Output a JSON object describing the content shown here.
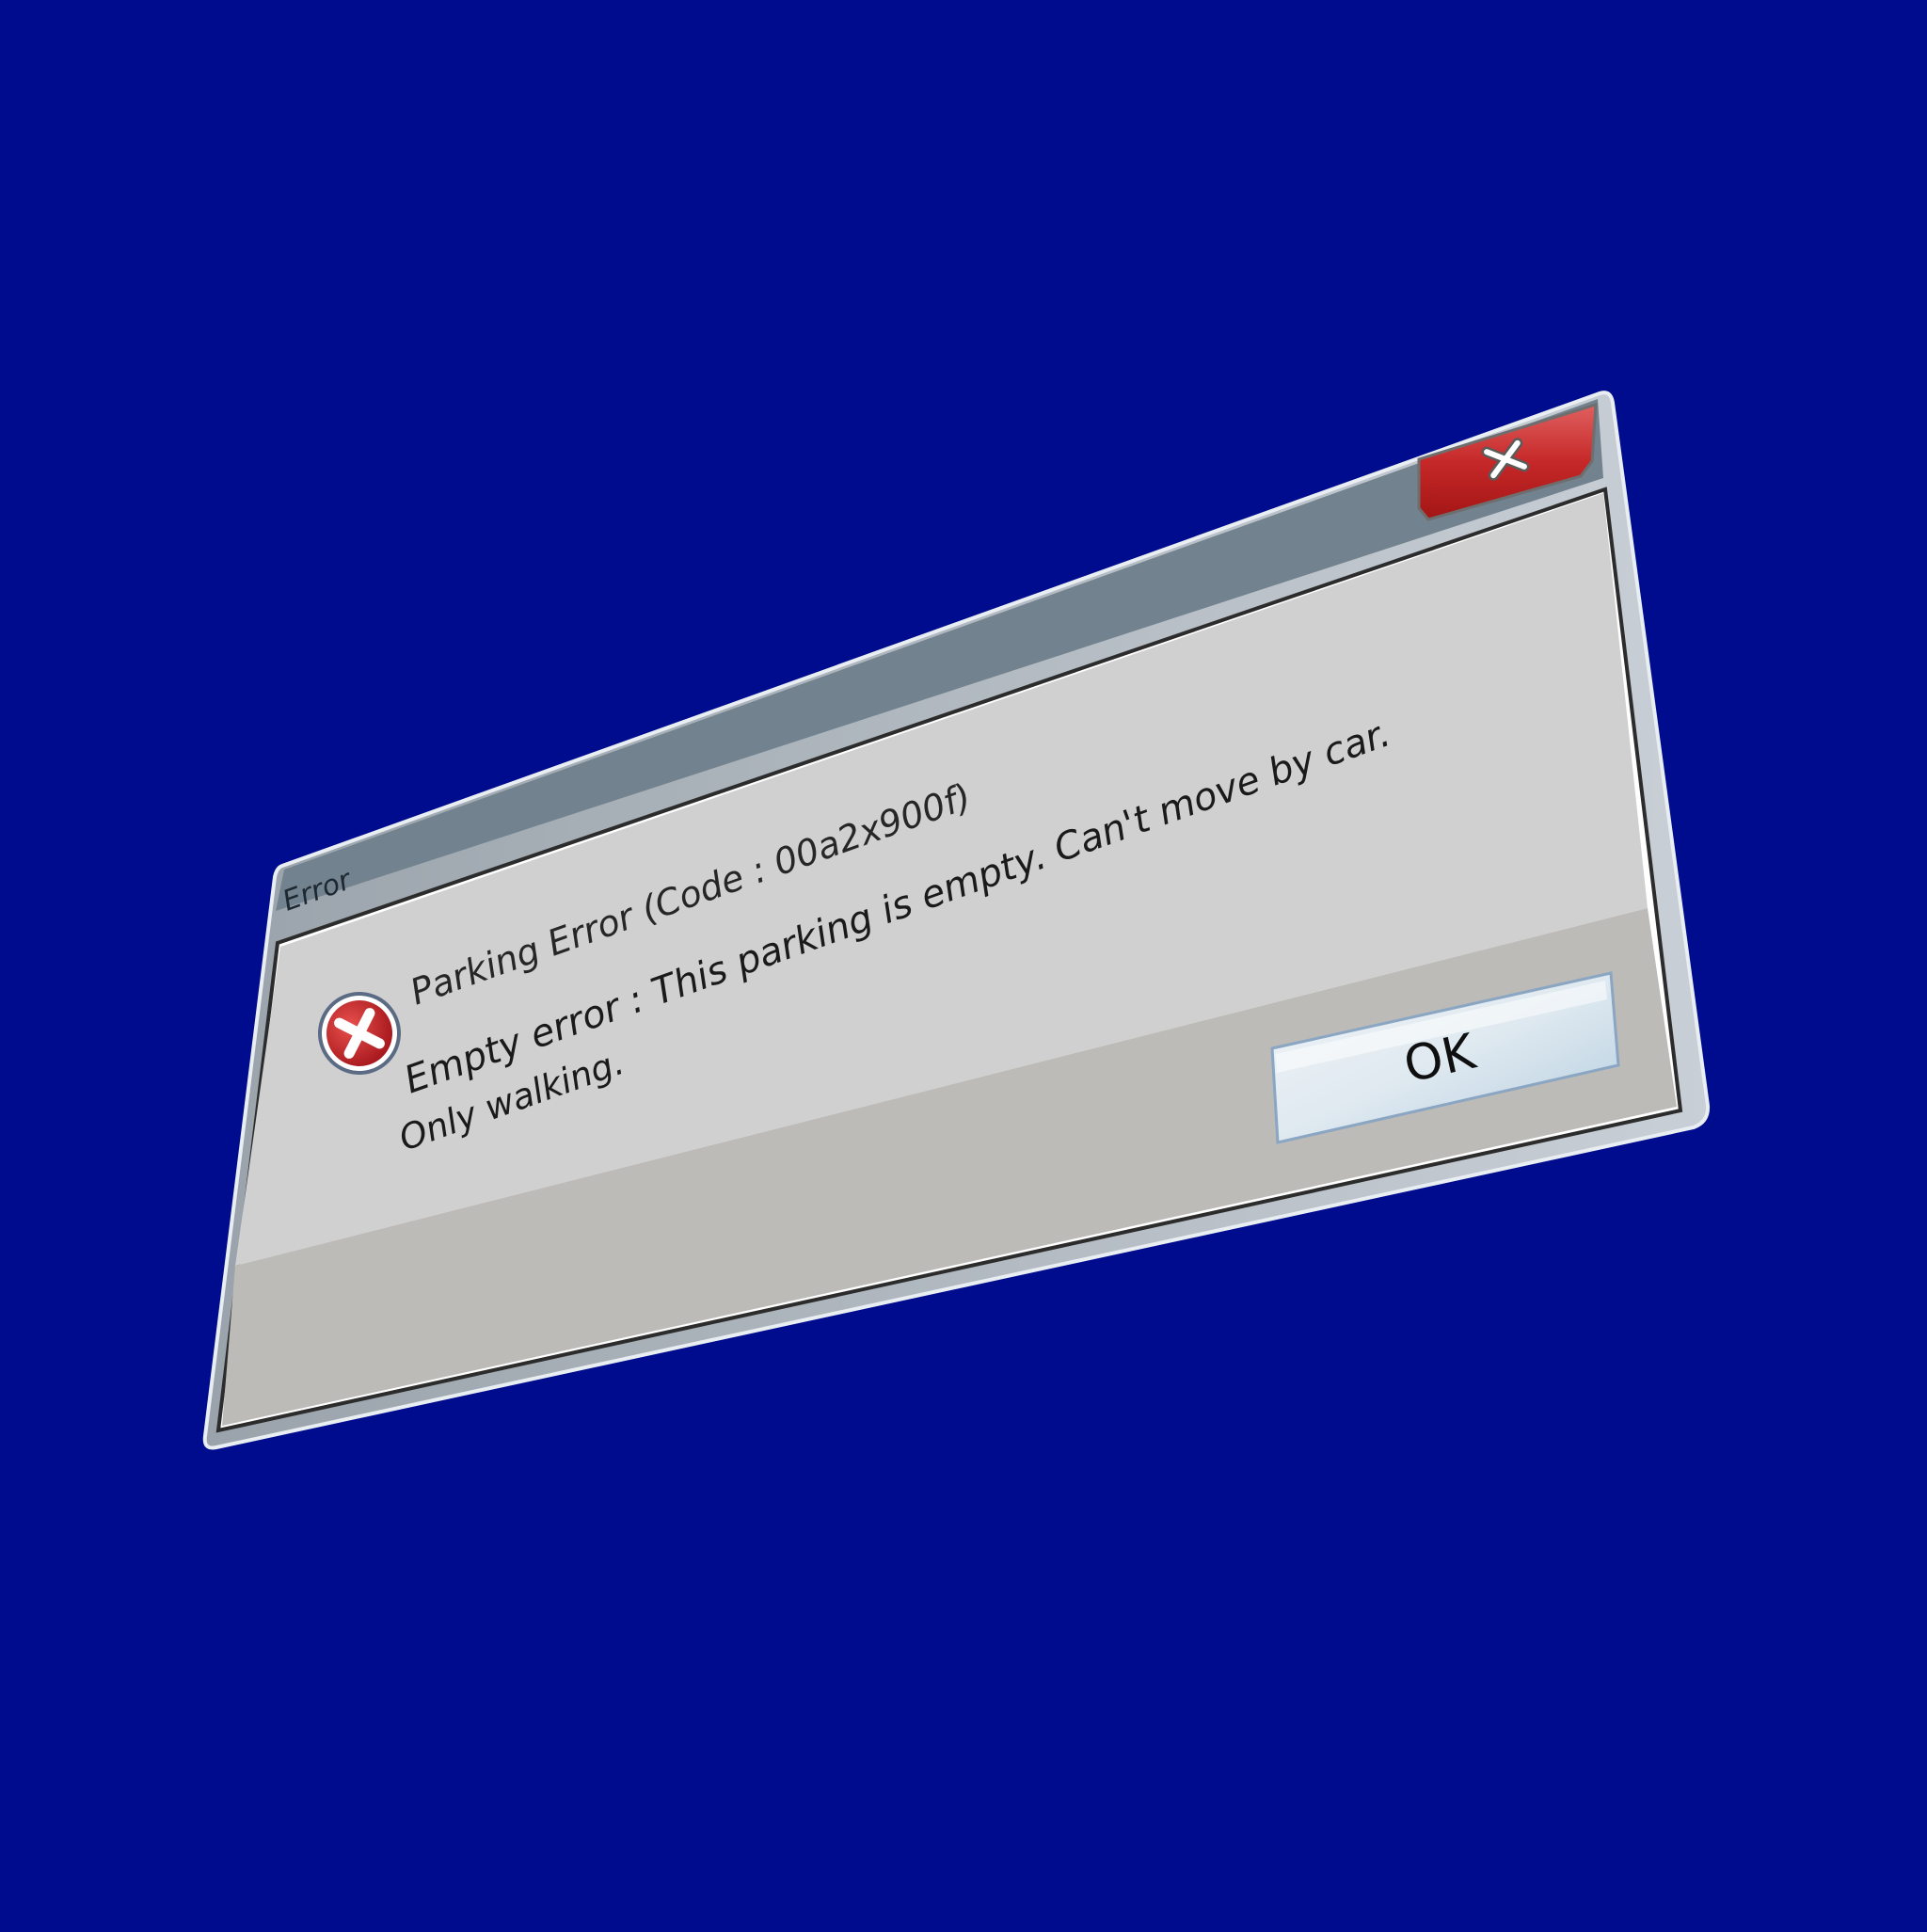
{
  "desktop": {
    "background_color": "#000c8e"
  },
  "dialog": {
    "title": "Error",
    "close_button": {
      "label": "X",
      "icon": "close-icon",
      "color": "#c62828"
    },
    "error_icon": "error-x-icon",
    "message": {
      "heading": "Parking Error (Code : 00a2x900f)",
      "line1": "Empty error : This parking is empty. Can't move by car.",
      "line2": "Only walking."
    },
    "ok_button": {
      "label": "OK"
    },
    "colors": {
      "titlebar": "#72828f",
      "body": "#d0d0d0",
      "body_lower": "#bcbbb8",
      "frame": "#b9c2cc"
    }
  }
}
